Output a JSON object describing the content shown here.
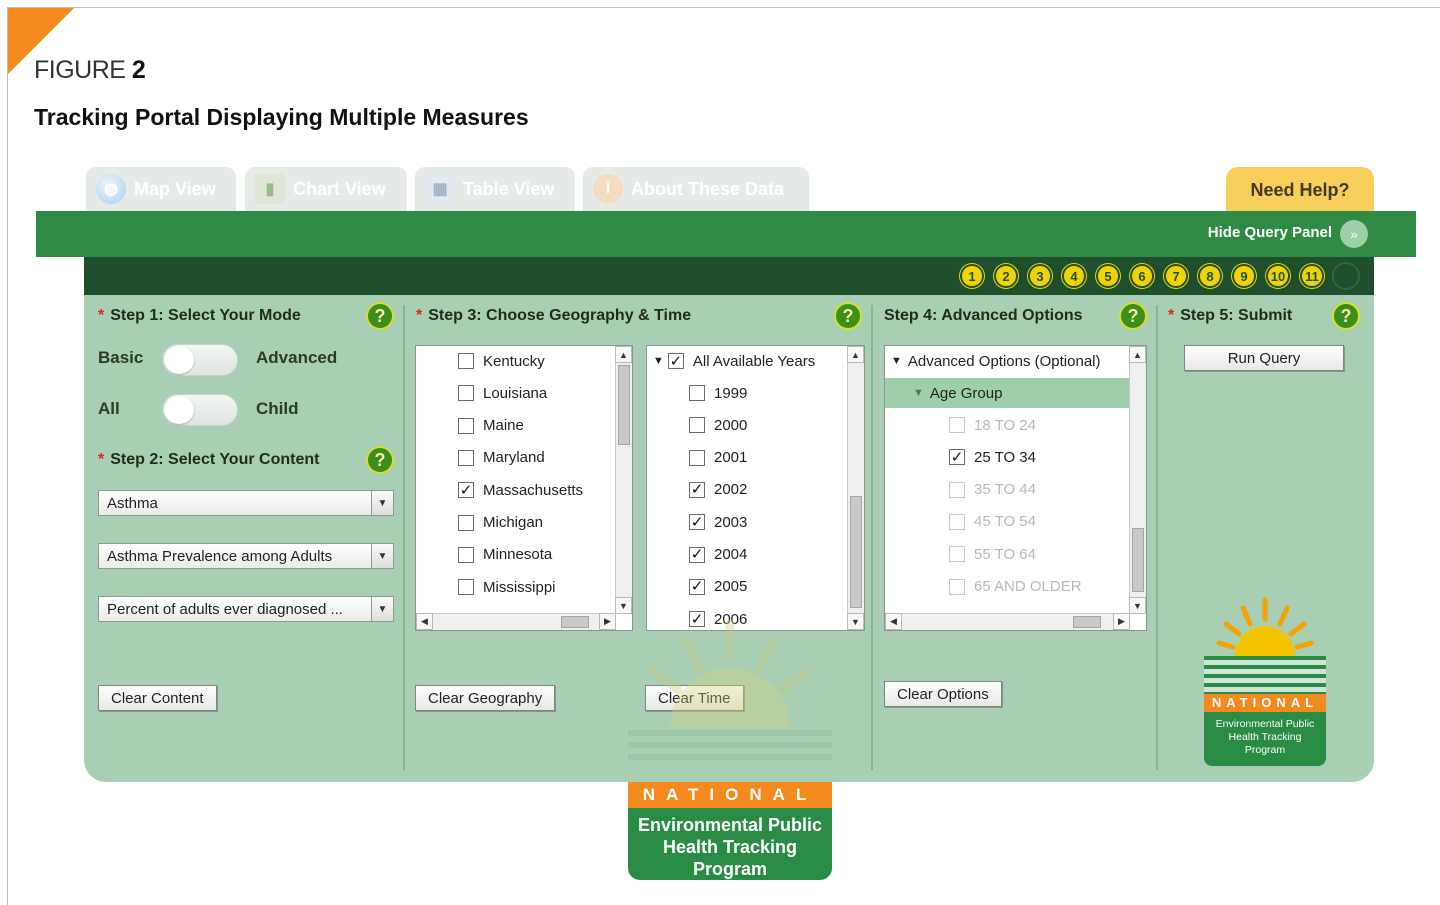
{
  "figure": {
    "label": "FIGURE",
    "number": "2",
    "title": "Tracking Portal Displaying Multiple Measures"
  },
  "tabs": [
    {
      "label": "Map View",
      "icon": "globe-icon"
    },
    {
      "label": "Chart View",
      "icon": "chart-icon"
    },
    {
      "label": "Table View",
      "icon": "table-icon"
    },
    {
      "label": "About These Data",
      "icon": "info-icon"
    }
  ],
  "help": {
    "label": "Need Help?"
  },
  "toolbar": {
    "hide_label": "Hide Query Panel",
    "hide_icon": "chevron-double-down-icon"
  },
  "steps_nav": [
    "1",
    "2",
    "3",
    "4",
    "5",
    "6",
    "7",
    "8",
    "9",
    "10",
    "11"
  ],
  "step1": {
    "title": "Step 1: Select Your Mode",
    "mode_left": "Basic",
    "mode_right": "Advanced",
    "pop_left": "All",
    "pop_right": "Child"
  },
  "step2": {
    "title": "Step 2: Select Your Content",
    "selects": [
      "Asthma",
      "Asthma Prevalence among Adults",
      "Percent of adults ever diagnosed ..."
    ],
    "clear_label": "Clear Content"
  },
  "step3": {
    "title": "Step 3: Choose Geography & Time",
    "geography": [
      {
        "label": "Kentucky",
        "checked": false
      },
      {
        "label": "Louisiana",
        "checked": false
      },
      {
        "label": "Maine",
        "checked": false
      },
      {
        "label": "Maryland",
        "checked": false
      },
      {
        "label": "Massachusetts",
        "checked": true
      },
      {
        "label": "Michigan",
        "checked": false
      },
      {
        "label": "Minnesota",
        "checked": false
      },
      {
        "label": "Mississippi",
        "checked": false
      }
    ],
    "years_header": "All Available Years",
    "years": [
      {
        "label": "1999",
        "checked": false
      },
      {
        "label": "2000",
        "checked": false
      },
      {
        "label": "2001",
        "checked": false
      },
      {
        "label": "2002",
        "checked": true
      },
      {
        "label": "2003",
        "checked": true
      },
      {
        "label": "2004",
        "checked": true
      },
      {
        "label": "2005",
        "checked": true
      },
      {
        "label": "2006",
        "checked": true
      }
    ],
    "clear_geo_label": "Clear Geography",
    "clear_time_label": "Clear Time"
  },
  "step4": {
    "title": "Step 4: Advanced Options",
    "root_label": "Advanced Options (Optional)",
    "group_label": "Age Group",
    "options": [
      {
        "label": "18 TO 24",
        "checked": false,
        "enabled": false
      },
      {
        "label": "25 TO 34",
        "checked": true,
        "enabled": true
      },
      {
        "label": "35 TO 44",
        "checked": false,
        "enabled": false
      },
      {
        "label": "45 TO 54",
        "checked": false,
        "enabled": false
      },
      {
        "label": "55 TO 64",
        "checked": false,
        "enabled": false
      },
      {
        "label": "65 AND OLDER",
        "checked": false,
        "enabled": false
      }
    ],
    "clear_label": "Clear Options"
  },
  "step5": {
    "title": "Step 5: Submit",
    "run_label": "Run Query"
  },
  "logo": {
    "national": "NATIONAL",
    "line1": "Environmental Public",
    "line2": "Health Tracking",
    "line3": "Program"
  },
  "colors": {
    "accent_orange": "#f28a1d",
    "portal_green": "#2f8a43",
    "panel_green": "#a8cfb4",
    "help_yellow": "#f7cf5a"
  }
}
